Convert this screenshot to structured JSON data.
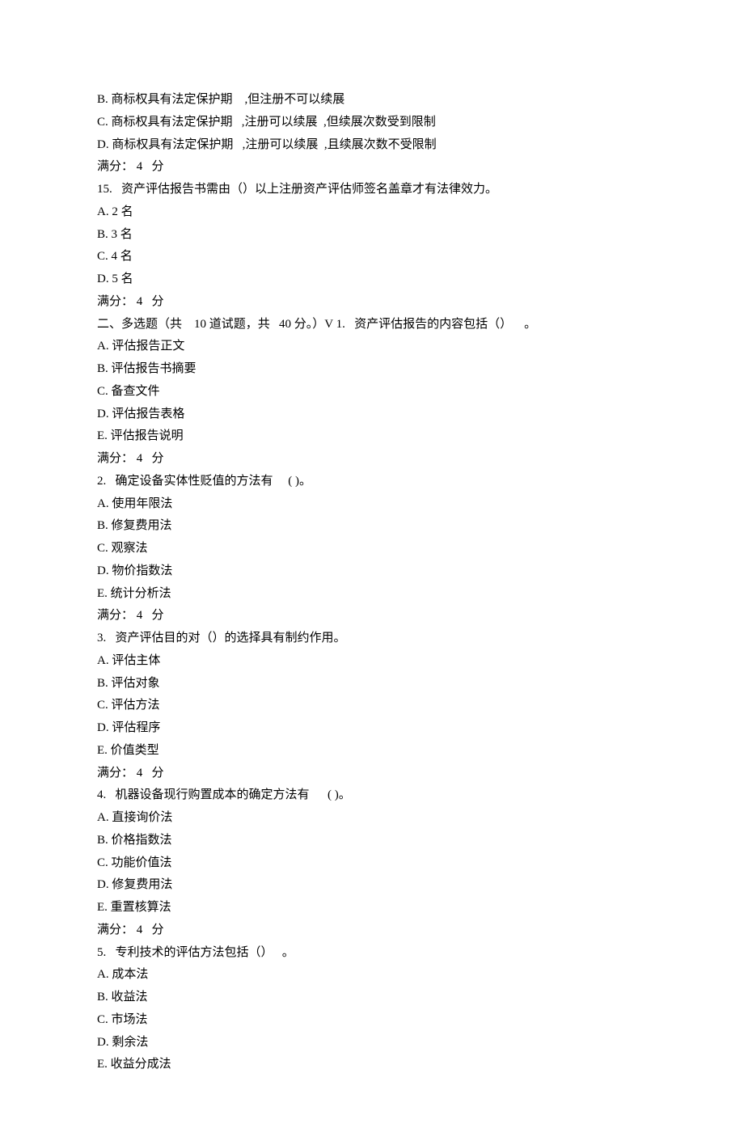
{
  "lines": [
    "B. 商标权具有法定保护期    ,但注册不可以续展",
    "C. 商标权具有法定保护期   ,注册可以续展  ,但续展次数受到限制",
    "D. 商标权具有法定保护期   ,注册可以续展  ,且续展次数不受限制",
    "满分： 4   分",
    "15.   资产评估报告书需由（）以上注册资产评估师签名盖章才有法律效力。",
    "A. 2 名",
    "B. 3 名",
    "C. 4 名",
    "D. 5 名",
    "满分： 4   分",
    "二、多选题（共    10 道试题，共   40 分。）V 1.   资产评估报告的内容包括（）    。",
    "A. 评估报告正文",
    "B. 评估报告书摘要",
    "C. 备查文件",
    "D. 评估报告表格",
    "E. 评估报告说明",
    "满分： 4   分",
    "2.   确定设备实体性贬值的方法有     ( )。",
    "A. 使用年限法",
    "B. 修复费用法",
    "C. 观察法",
    "D. 物价指数法",
    "E. 统计分析法",
    "满分： 4   分",
    "3.   资产评估目的对（）的选择具有制约作用。",
    "A. 评估主体",
    "B. 评估对象",
    "C. 评估方法",
    "D. 评估程序",
    "E. 价值类型",
    "满分： 4   分",
    "4.   机器设备现行购置成本的确定方法有      ( )。",
    "A. 直接询价法",
    "B. 价格指数法",
    "C. 功能价值法",
    "D. 修复费用法",
    "E. 重置核算法",
    "满分： 4   分",
    "5.   专利技术的评估方法包括（）   。",
    "A. 成本法",
    "B. 收益法",
    "C. 市场法",
    "D. 剩余法",
    "E. 收益分成法"
  ]
}
